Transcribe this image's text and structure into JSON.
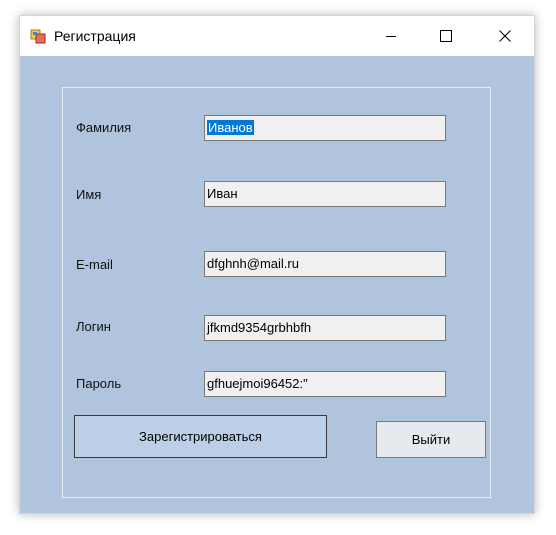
{
  "window": {
    "title": "Регистрация",
    "icon": "winforms-app-icon",
    "controls": [
      "minimize-icon",
      "maximize-icon",
      "close-icon"
    ]
  },
  "form": {
    "fields": [
      {
        "label": "Фамилия",
        "value": "Иванов",
        "selected": true
      },
      {
        "label": "Имя",
        "value": "Иван"
      },
      {
        "label": "E-mail",
        "value": "dfghnh@mail.ru"
      },
      {
        "label": "Логин",
        "value": "jfkmd9354grbhbfh"
      },
      {
        "label": "Пароль",
        "value": "gfhuejmoi96452:\""
      }
    ],
    "register_label": "Зарегистрироваться",
    "exit_label": "Выйти"
  },
  "colors": {
    "client_bg": "#b0c4de",
    "selection": "#0078d7",
    "register_bg": "#bccfe6"
  }
}
